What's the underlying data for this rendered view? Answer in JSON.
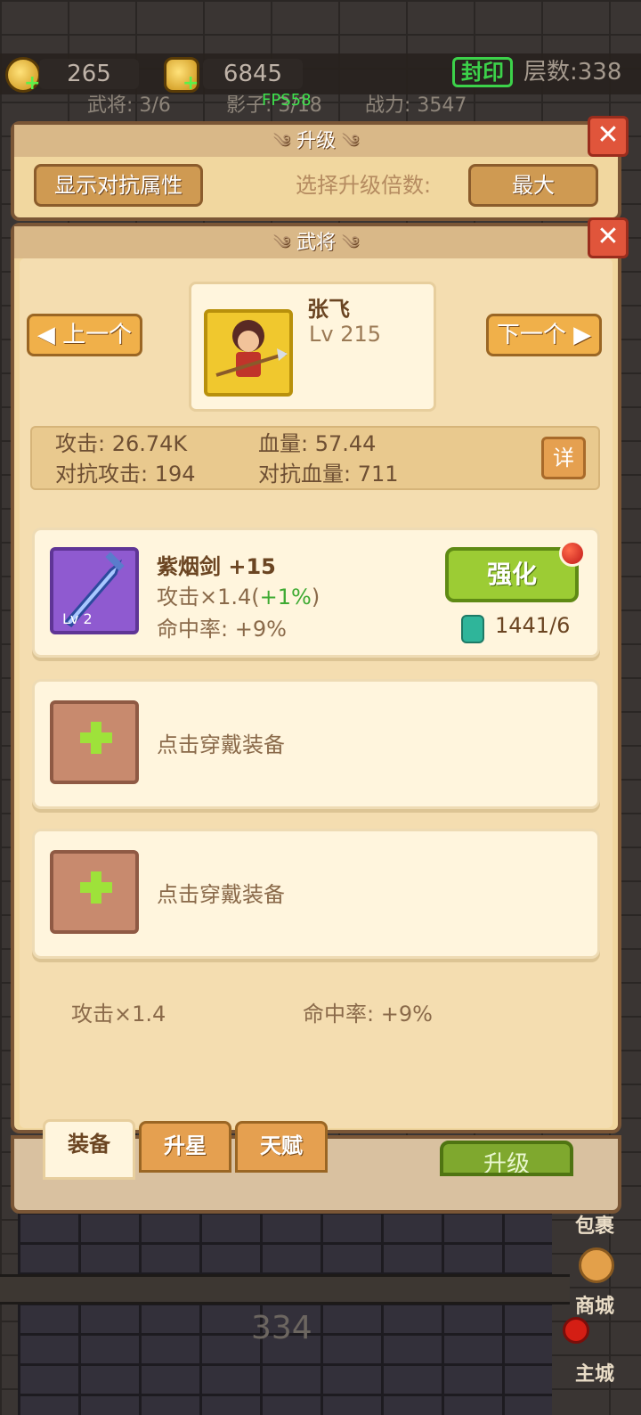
{
  "resources": {
    "coin": "265",
    "ingot": "6845",
    "seal_label": "封印",
    "floor_label": "层数:338"
  },
  "stats": {
    "generals": "武将: 3/6",
    "shadow": "影子: 3/18",
    "power": "战力: 3547",
    "fps": "FPS58"
  },
  "upgrade_panel": {
    "title": "升级",
    "show_attr_btn": "显示对抗属性",
    "multiplier_label": "选择升级倍数:",
    "multiplier_value": "最大"
  },
  "general_panel": {
    "title": "武将",
    "prev_btn": "上一个",
    "next_btn": "下一个",
    "hero": {
      "name": "张飞",
      "level": "Lv 215"
    },
    "attrs": {
      "attack": "攻击: 26.74K",
      "hp": "血量: 57.44",
      "counter_attack": "对抗攻击: 194",
      "counter_hp": "对抗血量: 711"
    },
    "detail_btn": "详",
    "equipment": {
      "level": "Lv 2",
      "name": "紫烟剑 +15",
      "attack": "攻击×1.4(",
      "attack_bonus": "+1%",
      "attack_close": ")",
      "hit": "命中率: +9%",
      "strengthen_btn": "强化",
      "gem_count": "1441/6"
    },
    "empty_slot_text": "点击穿戴装备",
    "summary": {
      "attack": "攻击×1.4",
      "hit": "命中率: +9%"
    },
    "tabs": [
      "装备",
      "升星",
      "天赋"
    ]
  },
  "bottom": {
    "upgrade_btn": "升级",
    "floor_number": "334",
    "bag": "包裹",
    "shop": "商城",
    "city": "主城"
  },
  "colors": {
    "accent_gold": "#f0b04a",
    "panel": "#f1d79f",
    "green_button": "#9ccc34",
    "close_red": "#e0553b",
    "purple_equip": "#8f5ad0"
  }
}
